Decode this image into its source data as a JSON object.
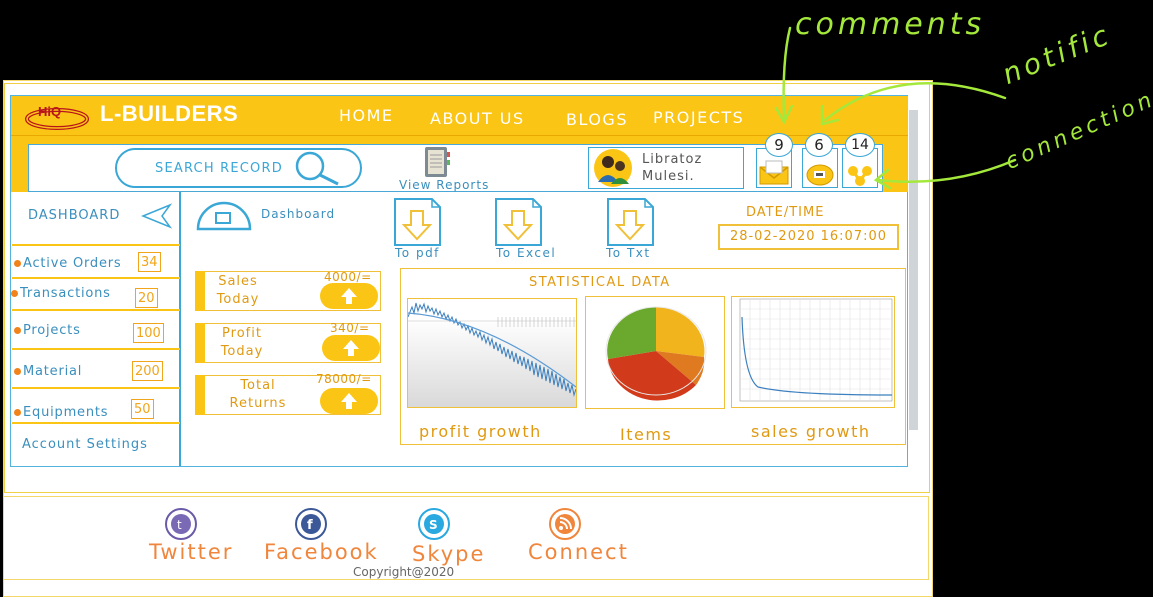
{
  "header": {
    "brand": "L-BUILDERS",
    "nav": [
      "HOME",
      "ABOUT US",
      "BLOGS",
      "PROJECTS"
    ]
  },
  "toolbar": {
    "search_label": "SEARCH RECORD",
    "view_reports": "View Reports",
    "user_name_line1": "Libratoz",
    "user_name_line2": "Mulesi.",
    "comments_count": "9",
    "notifications_count": "6",
    "connections_count": "14"
  },
  "sidebar": {
    "dashboard_label": "DASHBOARD",
    "items": [
      {
        "label": "Active Orders",
        "value": "34"
      },
      {
        "label": "Transactions",
        "value": "20"
      },
      {
        "label": "Projects",
        "value": "100"
      },
      {
        "label": "Material",
        "value": "200"
      },
      {
        "label": "Equipments",
        "value": "50"
      }
    ],
    "account_settings": "Account Settings"
  },
  "main": {
    "dashboard_label": "Dashboard",
    "exports": [
      "To pdf",
      "To Excel",
      "To Txt"
    ],
    "datetime_label": "DATE/TIME",
    "datetime_value": "28-02-2020 16:07:00",
    "stats": [
      {
        "label_line1": "Sales",
        "label_line2": "Today",
        "value": "4000/="
      },
      {
        "label_line1": "Profit",
        "label_line2": "Today",
        "value": "340/="
      },
      {
        "label_line1": "Total",
        "label_line2": "Returns",
        "value": "78000/="
      }
    ],
    "statistical_title": "STATISTICAL DATA",
    "chart_captions": [
      "profit growth",
      "Items",
      "sales growth"
    ]
  },
  "footer": {
    "social": [
      "Twitter",
      "Facebook",
      "Skype",
      "Connect"
    ],
    "copyright": "Copyright@2020"
  },
  "annotations": [
    "comments",
    "notific",
    "connections"
  ],
  "colors": {
    "accent_yellow": "#fbc515",
    "accent_blue": "#3aa7d6",
    "annotation_green": "#a4e83c",
    "social_orange": "#f0863c"
  }
}
